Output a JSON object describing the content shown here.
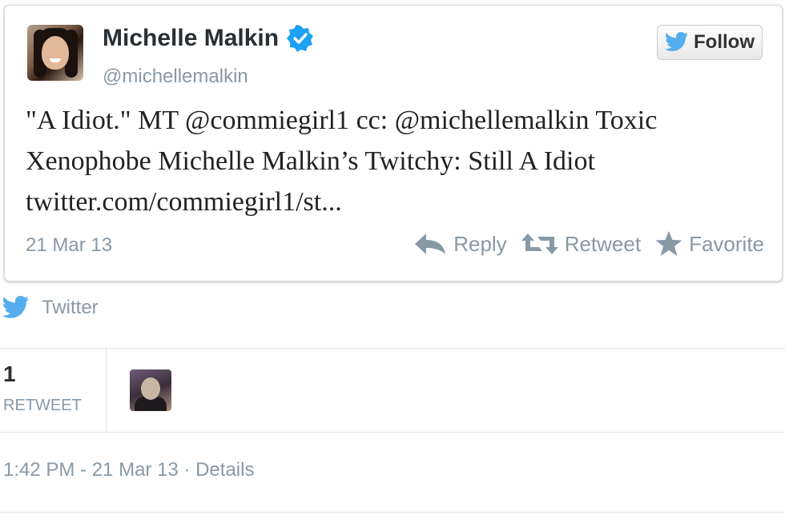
{
  "tweet": {
    "author_name": "Michelle Malkin",
    "author_handle": "@michellemalkin",
    "follow_label": "Follow",
    "text_lines": [
      "\"A Idiot.\" MT @commiegirl1 cc: @michellemalkin Toxic",
      "Xenophobe Michelle Malkin’s Twitchy: Still A Idiot",
      "twitter.com/commiegirl1/st..."
    ],
    "date": "21 Mar 13",
    "actions": {
      "reply": "Reply",
      "retweet": "Retweet",
      "favorite": "Favorite"
    }
  },
  "source": {
    "label": "Twitter"
  },
  "stats": {
    "retweet_count": "1",
    "retweet_label": "RETWEET"
  },
  "meta": {
    "timestamp": "1:42 PM - 21 Mar 13 · Details"
  },
  "colors": {
    "twitter_blue": "#55acee",
    "verified_blue": "#1da1f2",
    "muted_text": "#8899a6",
    "border": "#d8d8d8"
  },
  "icons": {
    "verified": "verified-badge-icon",
    "follow": "twitter-bird-icon",
    "reply": "reply-arrow-icon",
    "retweet": "retweet-icon",
    "favorite": "star-icon",
    "source": "twitter-bird-icon"
  }
}
